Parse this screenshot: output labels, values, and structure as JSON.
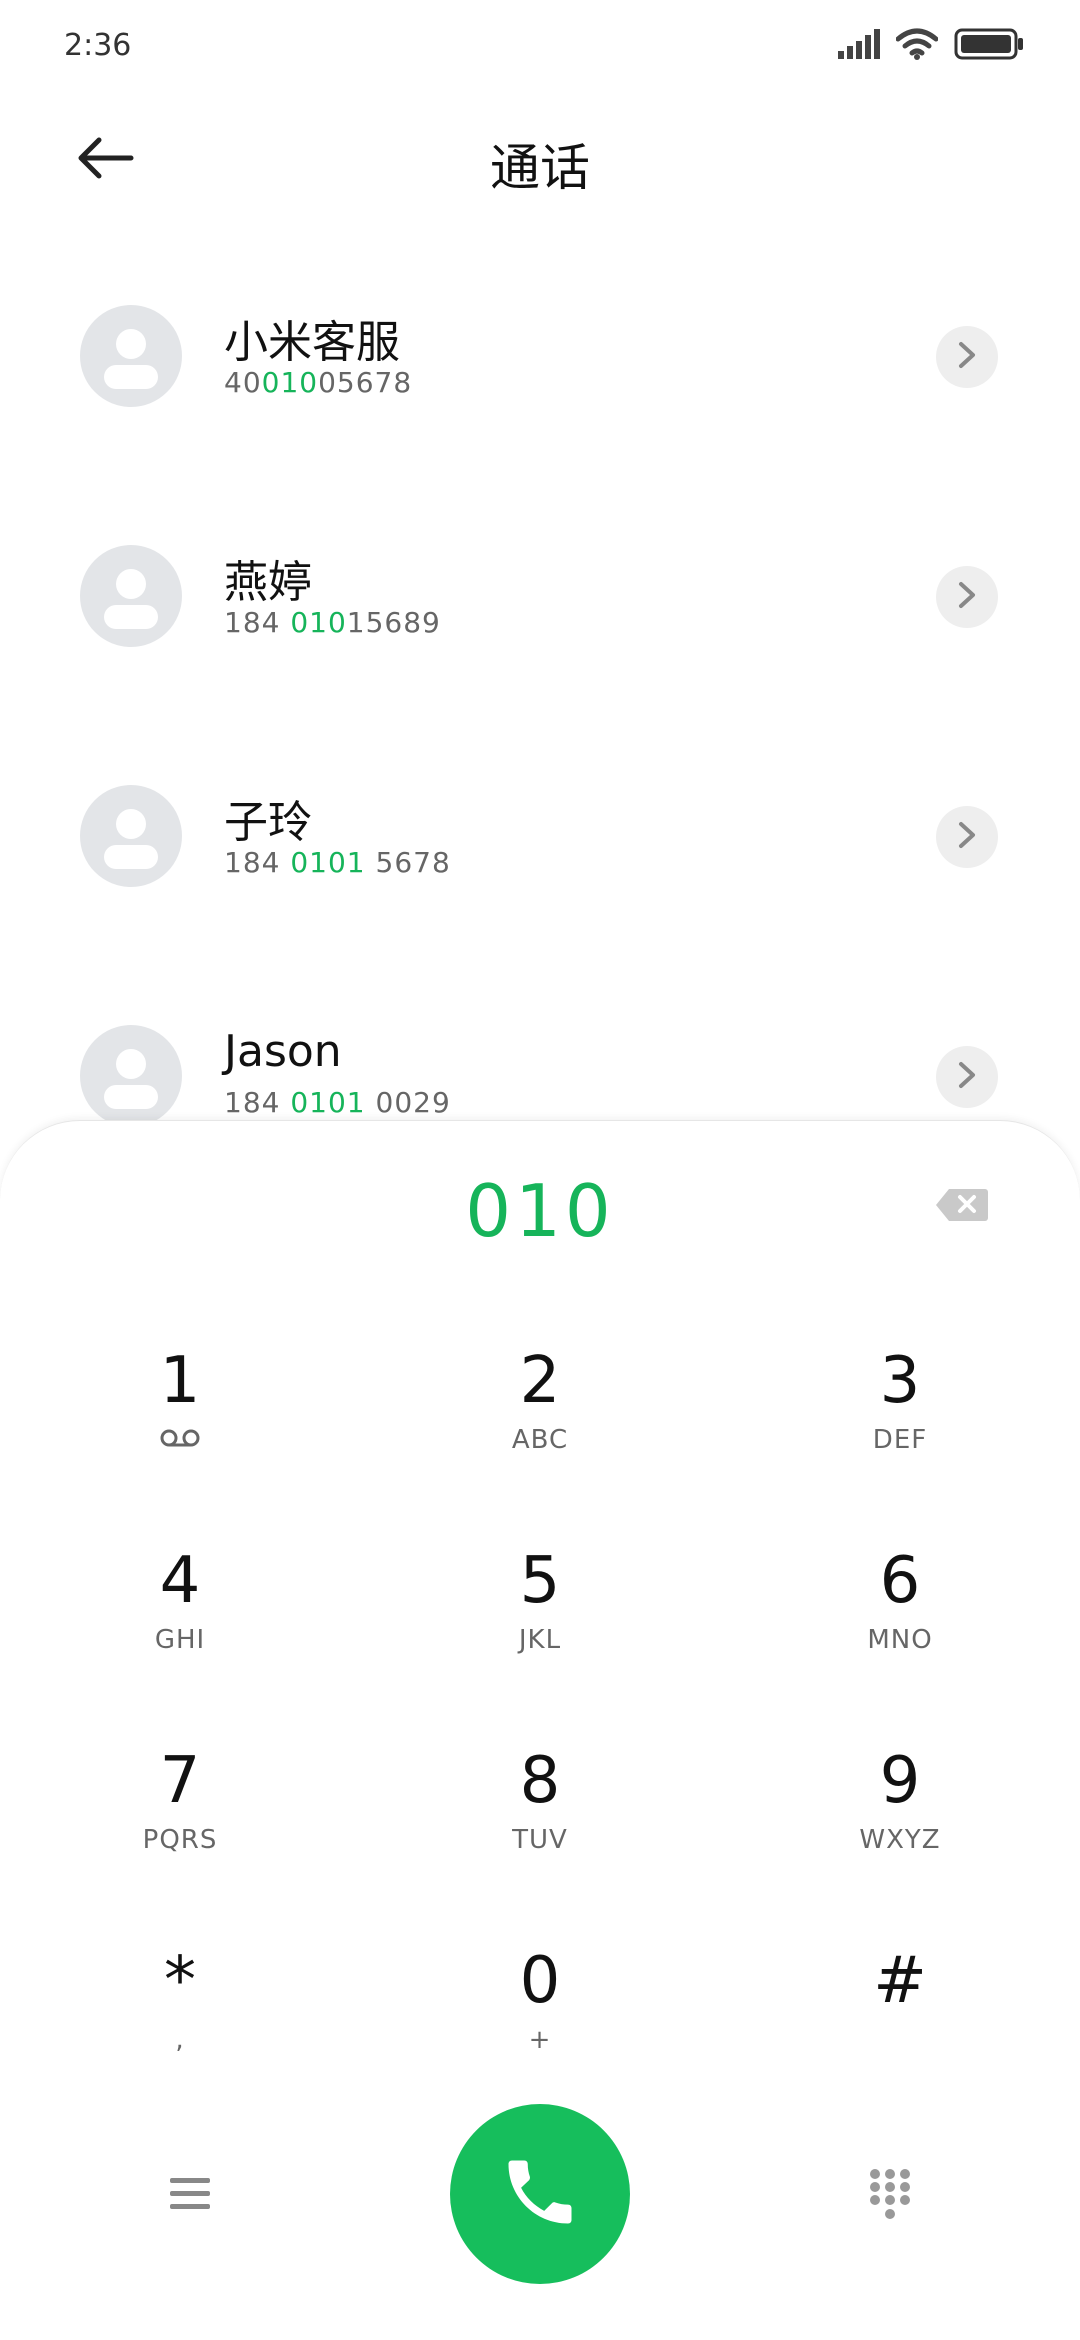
{
  "status_bar": {
    "time": "2:36"
  },
  "header": {
    "title": "通话"
  },
  "contacts": [
    {
      "name": "小米客服",
      "number_pre": "40",
      "number_hl": "010",
      "number_post": "05678"
    },
    {
      "name": "燕婷",
      "number_pre": "184 ",
      "number_hl": "010",
      "number_post": "15689"
    },
    {
      "name": "子玲",
      "number_pre": "184 ",
      "number_hl": "0101",
      "number_post": " 5678"
    },
    {
      "name": "Jason",
      "number_pre": "184 ",
      "number_hl": "0101",
      "number_post": " 0029"
    }
  ],
  "dialer": {
    "dialed": "010",
    "keys": [
      {
        "digit": "1",
        "letters": ""
      },
      {
        "digit": "2",
        "letters": "ABC"
      },
      {
        "digit": "3",
        "letters": "DEF"
      },
      {
        "digit": "4",
        "letters": "GHI"
      },
      {
        "digit": "5",
        "letters": "JKL"
      },
      {
        "digit": "6",
        "letters": "MNO"
      },
      {
        "digit": "7",
        "letters": "PQRS"
      },
      {
        "digit": "8",
        "letters": "TUV"
      },
      {
        "digit": "9",
        "letters": "WXYZ"
      },
      {
        "digit": "*",
        "letters": ","
      },
      {
        "digit": "0",
        "letters": "+"
      },
      {
        "digit": "#",
        "letters": ""
      }
    ]
  },
  "icons": {
    "back": "arrow-left-icon",
    "detail": "chevron-right-icon",
    "backspace": "backspace-icon",
    "voicemail": "voicemail-icon",
    "menu": "menu-icon",
    "call": "phone-icon",
    "dialpad": "dialpad-icon"
  },
  "colors": {
    "accent": "#16b45a",
    "call_button": "#16be5c"
  }
}
